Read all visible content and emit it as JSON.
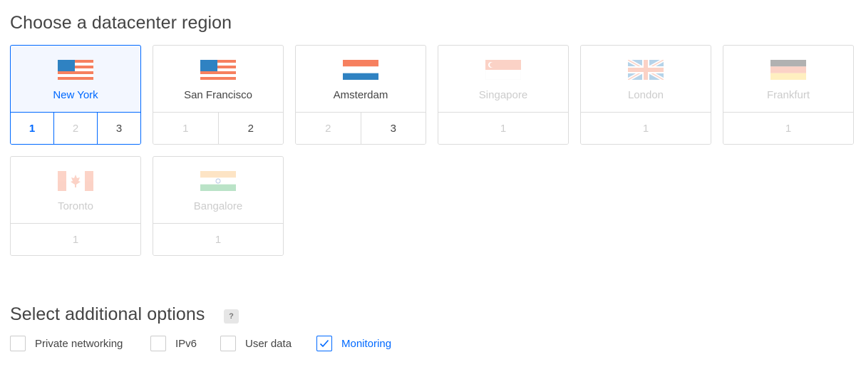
{
  "regions_heading": "Choose a datacenter region",
  "options_heading": "Select additional options",
  "help_badge": "?",
  "regions": [
    {
      "city": "New York",
      "flag": "us-flag",
      "numbers": [
        "1",
        "2",
        "3"
      ]
    },
    {
      "city": "San Francisco",
      "flag": "us-flag",
      "numbers": [
        "1",
        "2"
      ]
    },
    {
      "city": "Amsterdam",
      "flag": "nl-flag",
      "numbers": [
        "2",
        "3"
      ]
    },
    {
      "city": "Singapore",
      "flag": "sg-flag",
      "numbers": [
        "1"
      ]
    },
    {
      "city": "London",
      "flag": "uk-flag",
      "numbers": [
        "1"
      ]
    },
    {
      "city": "Frankfurt",
      "flag": "de-flag",
      "numbers": [
        "1"
      ]
    },
    {
      "city": "Toronto",
      "flag": "ca-flag",
      "numbers": [
        "1"
      ]
    },
    {
      "city": "Bangalore",
      "flag": "in-flag",
      "numbers": [
        "1"
      ]
    }
  ],
  "options": [
    {
      "label": "Private networking",
      "checked": false
    },
    {
      "label": "IPv6",
      "checked": false
    },
    {
      "label": "User data",
      "checked": false
    },
    {
      "label": "Monitoring",
      "checked": true
    }
  ],
  "colors": {
    "accent": "#0069ff",
    "flag_red": "#f6805f",
    "flag_blue": "#2f82c2"
  }
}
